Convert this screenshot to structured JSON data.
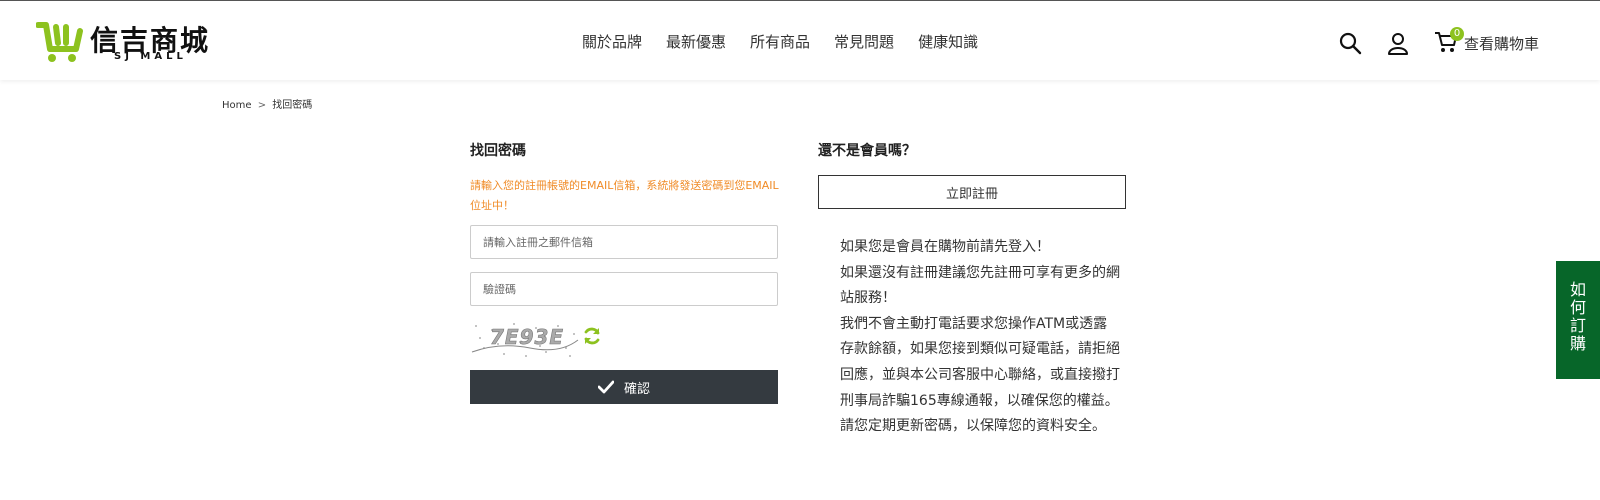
{
  "brand": {
    "name": "信吉商城",
    "subtitle": "SJ MALL",
    "color": "#8dc21f"
  },
  "nav": {
    "items": [
      "關於品牌",
      "最新優惠",
      "所有商品",
      "常見問題",
      "健康知識"
    ]
  },
  "header_icons": {
    "search": "search-icon",
    "account": "user-icon",
    "cart": "cart-icon"
  },
  "cart": {
    "count": "0",
    "label": "查看購物車"
  },
  "breadcrumb": {
    "home": "Home",
    "separator": ">",
    "current": "找回密碼"
  },
  "recover": {
    "title": "找回密碼",
    "hint": "請輸入您的註冊帳號的EMAIL信箱，系統將發送密碼到您EMAIL位址中！",
    "email_placeholder": "請輸入註冊之郵件信箱",
    "captcha_placeholder": "驗證碼",
    "captcha_code": "7E93E",
    "submit_label": "確認"
  },
  "register": {
    "title": "還不是會員嗎？",
    "button_label": "立即註冊",
    "notes": [
      "如果您是會員在購物前請先登入！",
      "如果還沒有註冊建議您先註冊可享有更多的網站服務！",
      "我們不會主動打電話要求您操作ATM或透露存款餘額，如果您接到類似可疑電話，請拒絕回應，並與本公司客服中心聯絡，或直接撥打刑事局詐騙165專線通報，以確保您的權益。",
      "請您定期更新密碼，以保障您的資料安全。"
    ]
  },
  "side_tab": {
    "label": "如何訂購",
    "color": "#076629"
  },
  "colors": {
    "hint_text": "#f08c28",
    "submit_bg": "#343a40"
  }
}
